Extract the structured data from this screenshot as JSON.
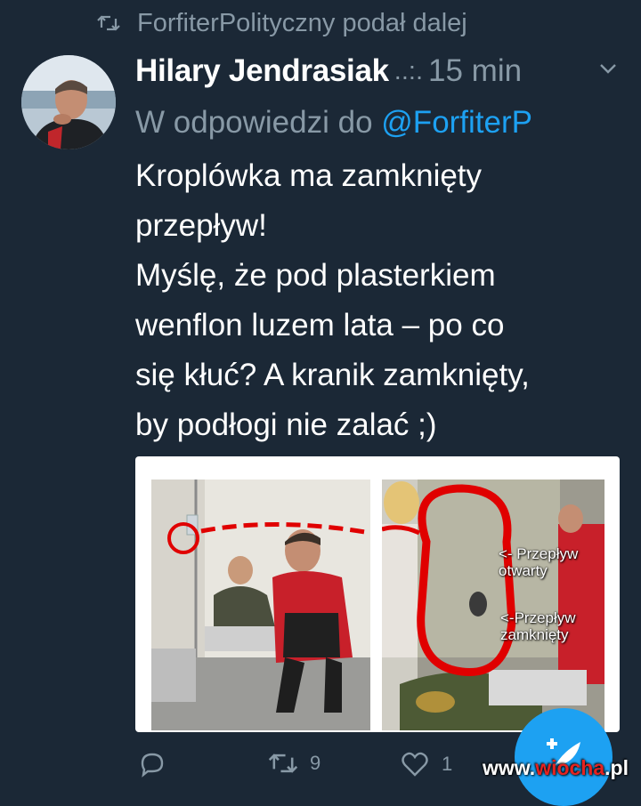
{
  "retweet": {
    "icon": "retweet-icon",
    "text": "ForfiterPolityczny podał dalej"
  },
  "tweet": {
    "author_name": "Hilary Jendrasiak",
    "handle_ellipsis": "..:.",
    "time": "15 min",
    "reply_prefix": "W odpowiedzi do",
    "reply_mention": "@ForfiterP",
    "lines": [
      "Kroplówka ma zamknięty",
      "przepływ!",
      "Myślę, że pod plasterkiem",
      "wenflon luzem lata – po co",
      "się kłuć? A kranik zamknięty,",
      "by podłogi nie zalać ;)"
    ]
  },
  "image": {
    "annotation_open": [
      "<- Przepływ",
      "otwarty"
    ],
    "annotation_closed": [
      "<-Przepływ",
      "zamknięty"
    ]
  },
  "actions": {
    "reply_count": "",
    "retweet_count": "9",
    "like_count": "1"
  },
  "fab": {
    "icon": "compose-icon"
  },
  "watermark": {
    "prefix": "www.",
    "brand": "wiocha",
    "suffix": ".pl"
  },
  "colors": {
    "background": "#1b2836",
    "secondary": "#8899a6",
    "accent": "#1da1f2",
    "annotation_red": "#e00000"
  }
}
